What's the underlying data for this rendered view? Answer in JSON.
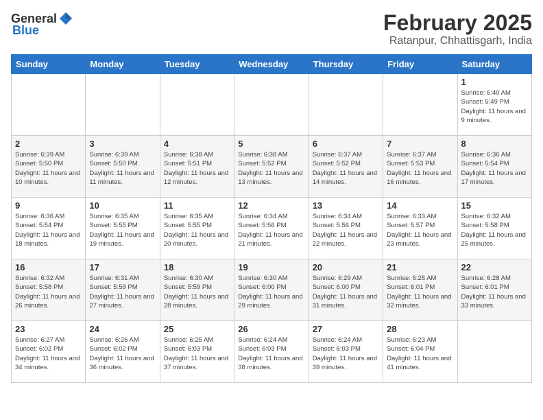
{
  "logo": {
    "general": "General",
    "blue": "Blue"
  },
  "title": "February 2025",
  "subtitle": "Ratanpur, Chhattisgarh, India",
  "weekdays": [
    "Sunday",
    "Monday",
    "Tuesday",
    "Wednesday",
    "Thursday",
    "Friday",
    "Saturday"
  ],
  "weeks": [
    [
      {
        "day": "",
        "sunrise": "",
        "sunset": "",
        "daylight": ""
      },
      {
        "day": "",
        "sunrise": "",
        "sunset": "",
        "daylight": ""
      },
      {
        "day": "",
        "sunrise": "",
        "sunset": "",
        "daylight": ""
      },
      {
        "day": "",
        "sunrise": "",
        "sunset": "",
        "daylight": ""
      },
      {
        "day": "",
        "sunrise": "",
        "sunset": "",
        "daylight": ""
      },
      {
        "day": "",
        "sunrise": "",
        "sunset": "",
        "daylight": ""
      },
      {
        "day": "1",
        "sunrise": "Sunrise: 6:40 AM",
        "sunset": "Sunset: 5:49 PM",
        "daylight": "Daylight: 11 hours and 9 minutes."
      }
    ],
    [
      {
        "day": "2",
        "sunrise": "Sunrise: 6:39 AM",
        "sunset": "Sunset: 5:50 PM",
        "daylight": "Daylight: 11 hours and 10 minutes."
      },
      {
        "day": "3",
        "sunrise": "Sunrise: 6:39 AM",
        "sunset": "Sunset: 5:50 PM",
        "daylight": "Daylight: 11 hours and 11 minutes."
      },
      {
        "day": "4",
        "sunrise": "Sunrise: 6:38 AM",
        "sunset": "Sunset: 5:51 PM",
        "daylight": "Daylight: 11 hours and 12 minutes."
      },
      {
        "day": "5",
        "sunrise": "Sunrise: 6:38 AM",
        "sunset": "Sunset: 5:52 PM",
        "daylight": "Daylight: 11 hours and 13 minutes."
      },
      {
        "day": "6",
        "sunrise": "Sunrise: 6:37 AM",
        "sunset": "Sunset: 5:52 PM",
        "daylight": "Daylight: 11 hours and 14 minutes."
      },
      {
        "day": "7",
        "sunrise": "Sunrise: 6:37 AM",
        "sunset": "Sunset: 5:53 PM",
        "daylight": "Daylight: 11 hours and 16 minutes."
      },
      {
        "day": "8",
        "sunrise": "Sunrise: 6:36 AM",
        "sunset": "Sunset: 5:54 PM",
        "daylight": "Daylight: 11 hours and 17 minutes."
      }
    ],
    [
      {
        "day": "9",
        "sunrise": "Sunrise: 6:36 AM",
        "sunset": "Sunset: 5:54 PM",
        "daylight": "Daylight: 11 hours and 18 minutes."
      },
      {
        "day": "10",
        "sunrise": "Sunrise: 6:35 AM",
        "sunset": "Sunset: 5:55 PM",
        "daylight": "Daylight: 11 hours and 19 minutes."
      },
      {
        "day": "11",
        "sunrise": "Sunrise: 6:35 AM",
        "sunset": "Sunset: 5:55 PM",
        "daylight": "Daylight: 11 hours and 20 minutes."
      },
      {
        "day": "12",
        "sunrise": "Sunrise: 6:34 AM",
        "sunset": "Sunset: 5:56 PM",
        "daylight": "Daylight: 11 hours and 21 minutes."
      },
      {
        "day": "13",
        "sunrise": "Sunrise: 6:34 AM",
        "sunset": "Sunset: 5:56 PM",
        "daylight": "Daylight: 11 hours and 22 minutes."
      },
      {
        "day": "14",
        "sunrise": "Sunrise: 6:33 AM",
        "sunset": "Sunset: 5:57 PM",
        "daylight": "Daylight: 11 hours and 23 minutes."
      },
      {
        "day": "15",
        "sunrise": "Sunrise: 6:32 AM",
        "sunset": "Sunset: 5:58 PM",
        "daylight": "Daylight: 11 hours and 25 minutes."
      }
    ],
    [
      {
        "day": "16",
        "sunrise": "Sunrise: 6:32 AM",
        "sunset": "Sunset: 5:58 PM",
        "daylight": "Daylight: 11 hours and 26 minutes."
      },
      {
        "day": "17",
        "sunrise": "Sunrise: 6:31 AM",
        "sunset": "Sunset: 5:59 PM",
        "daylight": "Daylight: 11 hours and 27 minutes."
      },
      {
        "day": "18",
        "sunrise": "Sunrise: 6:30 AM",
        "sunset": "Sunset: 5:59 PM",
        "daylight": "Daylight: 11 hours and 28 minutes."
      },
      {
        "day": "19",
        "sunrise": "Sunrise: 6:30 AM",
        "sunset": "Sunset: 6:00 PM",
        "daylight": "Daylight: 11 hours and 29 minutes."
      },
      {
        "day": "20",
        "sunrise": "Sunrise: 6:29 AM",
        "sunset": "Sunset: 6:00 PM",
        "daylight": "Daylight: 11 hours and 31 minutes."
      },
      {
        "day": "21",
        "sunrise": "Sunrise: 6:28 AM",
        "sunset": "Sunset: 6:01 PM",
        "daylight": "Daylight: 11 hours and 32 minutes."
      },
      {
        "day": "22",
        "sunrise": "Sunrise: 6:28 AM",
        "sunset": "Sunset: 6:01 PM",
        "daylight": "Daylight: 11 hours and 33 minutes."
      }
    ],
    [
      {
        "day": "23",
        "sunrise": "Sunrise: 6:27 AM",
        "sunset": "Sunset: 6:02 PM",
        "daylight": "Daylight: 11 hours and 34 minutes."
      },
      {
        "day": "24",
        "sunrise": "Sunrise: 6:26 AM",
        "sunset": "Sunset: 6:02 PM",
        "daylight": "Daylight: 11 hours and 36 minutes."
      },
      {
        "day": "25",
        "sunrise": "Sunrise: 6:25 AM",
        "sunset": "Sunset: 6:03 PM",
        "daylight": "Daylight: 11 hours and 37 minutes."
      },
      {
        "day": "26",
        "sunrise": "Sunrise: 6:24 AM",
        "sunset": "Sunset: 6:03 PM",
        "daylight": "Daylight: 11 hours and 38 minutes."
      },
      {
        "day": "27",
        "sunrise": "Sunrise: 6:24 AM",
        "sunset": "Sunset: 6:03 PM",
        "daylight": "Daylight: 11 hours and 39 minutes."
      },
      {
        "day": "28",
        "sunrise": "Sunrise: 6:23 AM",
        "sunset": "Sunset: 6:04 PM",
        "daylight": "Daylight: 11 hours and 41 minutes."
      },
      {
        "day": "",
        "sunrise": "",
        "sunset": "",
        "daylight": ""
      }
    ]
  ]
}
